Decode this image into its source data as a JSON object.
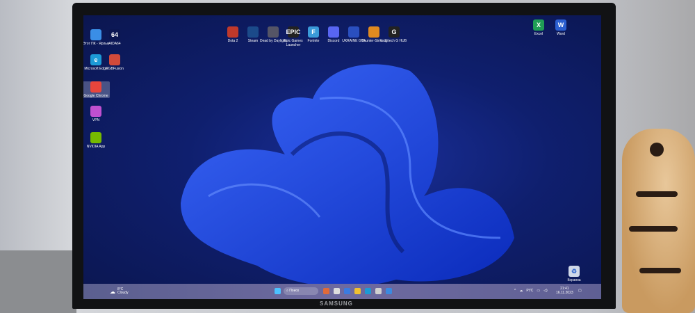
{
  "desktop": {
    "left_icons": [
      {
        "label": "Этот ПК - Ярлык",
        "color": "#3a8ee6",
        "glyph": ""
      },
      {
        "label": "AIDA64",
        "color": "#0b1650",
        "glyph": "64"
      },
      {
        "label": "Microsoft Edge",
        "color": "#1c9ad6",
        "glyph": "e"
      },
      {
        "label": "RGBFusion",
        "color": "#d24a3a",
        "glyph": ""
      },
      {
        "label": "Google Chrome",
        "color": "#e8453c",
        "glyph": ""
      },
      {
        "label": "VPN",
        "color": "#c050d0",
        "glyph": ""
      },
      {
        "label": "NVIDIA App",
        "color": "#76b900",
        "glyph": ""
      }
    ],
    "top_icons": [
      {
        "label": "Dota 2",
        "color": "#c0392b",
        "glyph": ""
      },
      {
        "label": "Steam",
        "color": "#1b4a8a",
        "glyph": ""
      },
      {
        "label": "Dead by Daylight",
        "color": "#556",
        "glyph": ""
      },
      {
        "label": "Epic Games Launcher",
        "color": "#222",
        "glyph": "EPIC"
      },
      {
        "label": "Fortnite",
        "color": "#3a9ad9",
        "glyph": "F"
      },
      {
        "label": "Discord",
        "color": "#5865f2",
        "glyph": ""
      },
      {
        "label": "UKRAINE GTA",
        "color": "#2a4fbf",
        "glyph": ""
      },
      {
        "label": "Counter-Strike 2",
        "color": "#e08a20",
        "glyph": ""
      },
      {
        "label": "Logitech G HUB",
        "color": "#222",
        "glyph": "G"
      }
    ],
    "right_icons": [
      {
        "label": "Excel",
        "color": "#1f9d55",
        "glyph": "X"
      },
      {
        "label": "Word",
        "color": "#2b5fd0",
        "glyph": "W"
      }
    ],
    "recycle_bin": "Корзина"
  },
  "taskbar": {
    "weather_temp": "8°C",
    "weather_text": "Cloudy",
    "search_placeholder": "Поиск",
    "apps": [
      "#e06a3a",
      "#ddd",
      "#3b7be0",
      "#f0c030",
      "#1c9ad6",
      "#d0d0d0",
      "#3b8ae0"
    ],
    "language": "РУС",
    "time": "21:41",
    "date": "16.11.2023"
  },
  "monitor_brand": "SAMSUNG"
}
